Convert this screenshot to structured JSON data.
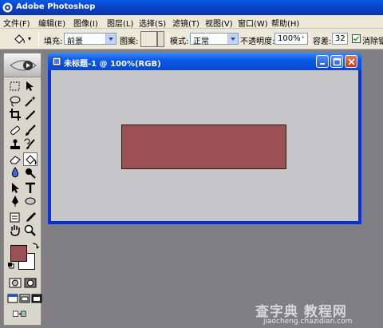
{
  "app": {
    "title": "Adobe Photoshop"
  },
  "menu": [
    {
      "label": "文件(F)"
    },
    {
      "label": "编辑(E)"
    },
    {
      "label": "图像(I)"
    },
    {
      "label": "图层(L)"
    },
    {
      "label": "选择(S)"
    },
    {
      "label": "滤镜(T)"
    },
    {
      "label": "视图(V)"
    },
    {
      "label": "窗口(W)"
    },
    {
      "label": "帮助(H)"
    }
  ],
  "options": {
    "fill_label": "填充:",
    "fill_value": "前景",
    "pattern_label": "图案:",
    "mode_label": "模式:",
    "mode_value": "正常",
    "opacity_label": "不透明度:",
    "opacity_value": "100%",
    "tolerance_label": "容差:",
    "tolerance_value": "32",
    "antialias_label": "消除锯",
    "antialias_checked": true
  },
  "colors": {
    "foreground": "#9b5053",
    "background": "#ffffff",
    "canvas": "#c6c6c8",
    "workspace": "#807f84"
  },
  "document": {
    "title": "未标题-1 @ 100%(RGB)",
    "shape_color": "#9b5053"
  },
  "toolbox": {
    "active_tool": "paint-bucket-icon",
    "tools": [
      "marquee-icon",
      "move-icon",
      "lasso-icon",
      "magic-wand-icon",
      "crop-icon",
      "slice-icon",
      "healing-brush-icon",
      "brush-icon",
      "clone-stamp-icon",
      "history-brush-icon",
      "eraser-icon",
      "paint-bucket-icon",
      "blur-icon",
      "dodge-icon",
      "path-select-icon",
      "type-icon",
      "pen-icon",
      "ellipse-shape-icon",
      "notes-icon",
      "eyedropper-icon",
      "hand-icon",
      "zoom-icon"
    ]
  },
  "watermark": {
    "main": "查字典 教程网",
    "sub": "jiaocheng.chazidian.com"
  }
}
